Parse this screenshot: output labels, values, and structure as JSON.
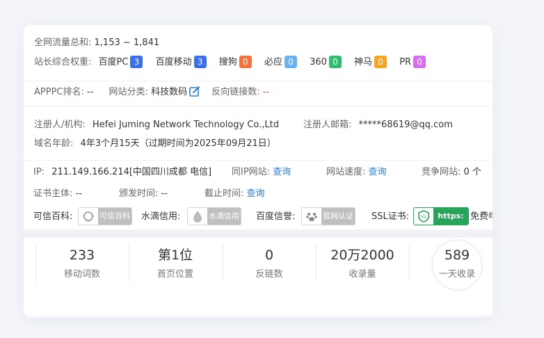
{
  "traffic": {
    "label": "全网流量总和:",
    "value": "1,153 ~ 1,841"
  },
  "weights": {
    "label": "站长综合权重:",
    "items": [
      {
        "name": "百度PC",
        "value": "3",
        "color": "#3a6ff0"
      },
      {
        "name": "百度移动",
        "value": "3",
        "color": "#3a6ff0"
      },
      {
        "name": "搜狗",
        "value": "0",
        "color": "#f2733b"
      },
      {
        "name": "必应",
        "value": "0",
        "color": "#69b3f5"
      },
      {
        "name": "360",
        "value": "0",
        "color": "#2fbf6b"
      },
      {
        "name": "神马",
        "value": "0",
        "color": "#f6a623"
      },
      {
        "name": "PR",
        "value": "0",
        "color": "#d66ef0"
      }
    ]
  },
  "apppc": {
    "label": "APPPC排名:",
    "value": "--",
    "category_label": "网站分类:",
    "category_value": "科技数码",
    "backlinks_label": "反向链接数:",
    "backlinks_value": "--"
  },
  "registrant": {
    "label": "注册人/机构:",
    "value": "Hefei Juming Network Technology Co.,Ltd",
    "email_label": "注册人邮箱:",
    "email_value": "*****68619@qq.com"
  },
  "domain_age": {
    "label": "域名年龄:",
    "value": "4年3个月15天（过期时间为2025年09月21日）"
  },
  "ip": {
    "label": "IP:",
    "value": "211.149.166.214[中国四川成都 电信]",
    "same_ip_label": "同IP网站:",
    "same_ip_link": "查询",
    "speed_label": "网站速度:",
    "speed_link": "查询",
    "competitor_label": "竞争网站:",
    "competitor_value": "0 个"
  },
  "cert": {
    "subject_label": "证书主体:",
    "subject_value": "--",
    "issued_label": "颁发时间:",
    "issued_value": "--",
    "expiry_label": "截止时间:",
    "expiry_link": "查询"
  },
  "trust": {
    "kexin_label": "可信百科:",
    "kexin_badge": "可信百科",
    "shuidi_label": "水滴信用:",
    "shuidi_badge": "水滴信用",
    "baidu_label": "百度信誉:",
    "baidu_badge": "官网认证",
    "ssl_label": "SSL证书:",
    "ssl_badge": "https:",
    "ssl_icon_text": "SSL",
    "ssl_free": "免费申"
  },
  "stats": [
    {
      "value": "233",
      "caption": "移动词数"
    },
    {
      "value": "第1位",
      "caption": "首页位置"
    },
    {
      "value": "0",
      "caption": "反链数"
    },
    {
      "value": "20万2000",
      "caption": "收录量"
    },
    {
      "value": "589",
      "caption": "一天收录"
    }
  ]
}
